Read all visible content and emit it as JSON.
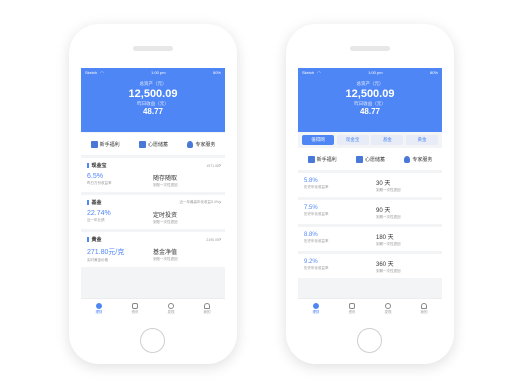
{
  "colors": {
    "accent": "#4f86f6",
    "background": "#f3f4f6"
  },
  "status_bar": {
    "carrier": "Sketch",
    "time": "1:00 pm",
    "battery": "80%"
  },
  "header": {
    "assets_label": "总资产（元）",
    "assets_value": "12,500.09",
    "income_label": "昨日收益（元）",
    "income_value": "48.77"
  },
  "quick_actions": [
    {
      "label": "新手福利",
      "icon": "gift-icon"
    },
    {
      "label": "心愿储蓄",
      "icon": "wish-icon"
    },
    {
      "label": "专家服务",
      "icon": "person-icon"
    }
  ],
  "left_cards": [
    {
      "title": "现金宝",
      "note": "1971.08",
      "v1": "6.5%",
      "s1": "昨日万份收益率",
      "v2": "随存随取",
      "s2": "到账一次性退回"
    },
    {
      "title": "基金",
      "note": "近一年最高年化收益5.4%",
      "v1": "22.74%",
      "s1": "近一年业绩",
      "v2": "定时投资",
      "s2": "到账一次性退回"
    },
    {
      "title": "黄金",
      "note": "2190.09",
      "v1": "271.80元/克",
      "s1": "实时黄金价格",
      "v2": "基金净值",
      "s2": "到账一次性退回"
    }
  ],
  "segments": [
    "值得网",
    "现金宝",
    "基金",
    "黄金"
  ],
  "right_rows": [
    {
      "v1": "5.8%",
      "s1": "历史年化收益率",
      "v2": "30 天",
      "s2": "到期一次性退回"
    },
    {
      "v1": "7.5%",
      "s1": "历史年化收益率",
      "v2": "90 天",
      "s2": "到期一次性退回"
    },
    {
      "v1": "8.8%",
      "s1": "历史年化收益率",
      "v2": "180 天",
      "s2": "到期一次性退回"
    },
    {
      "v1": "9.2%",
      "s1": "历史年化收益率",
      "v2": "360 天",
      "s2": "到期一次性退回"
    }
  ],
  "tabbar": [
    {
      "label": "理财",
      "icon": "home-icon"
    },
    {
      "label": "资讯",
      "icon": "news-icon"
    },
    {
      "label": "发现",
      "icon": "compass-icon"
    },
    {
      "label": "我的",
      "icon": "user-icon"
    }
  ]
}
